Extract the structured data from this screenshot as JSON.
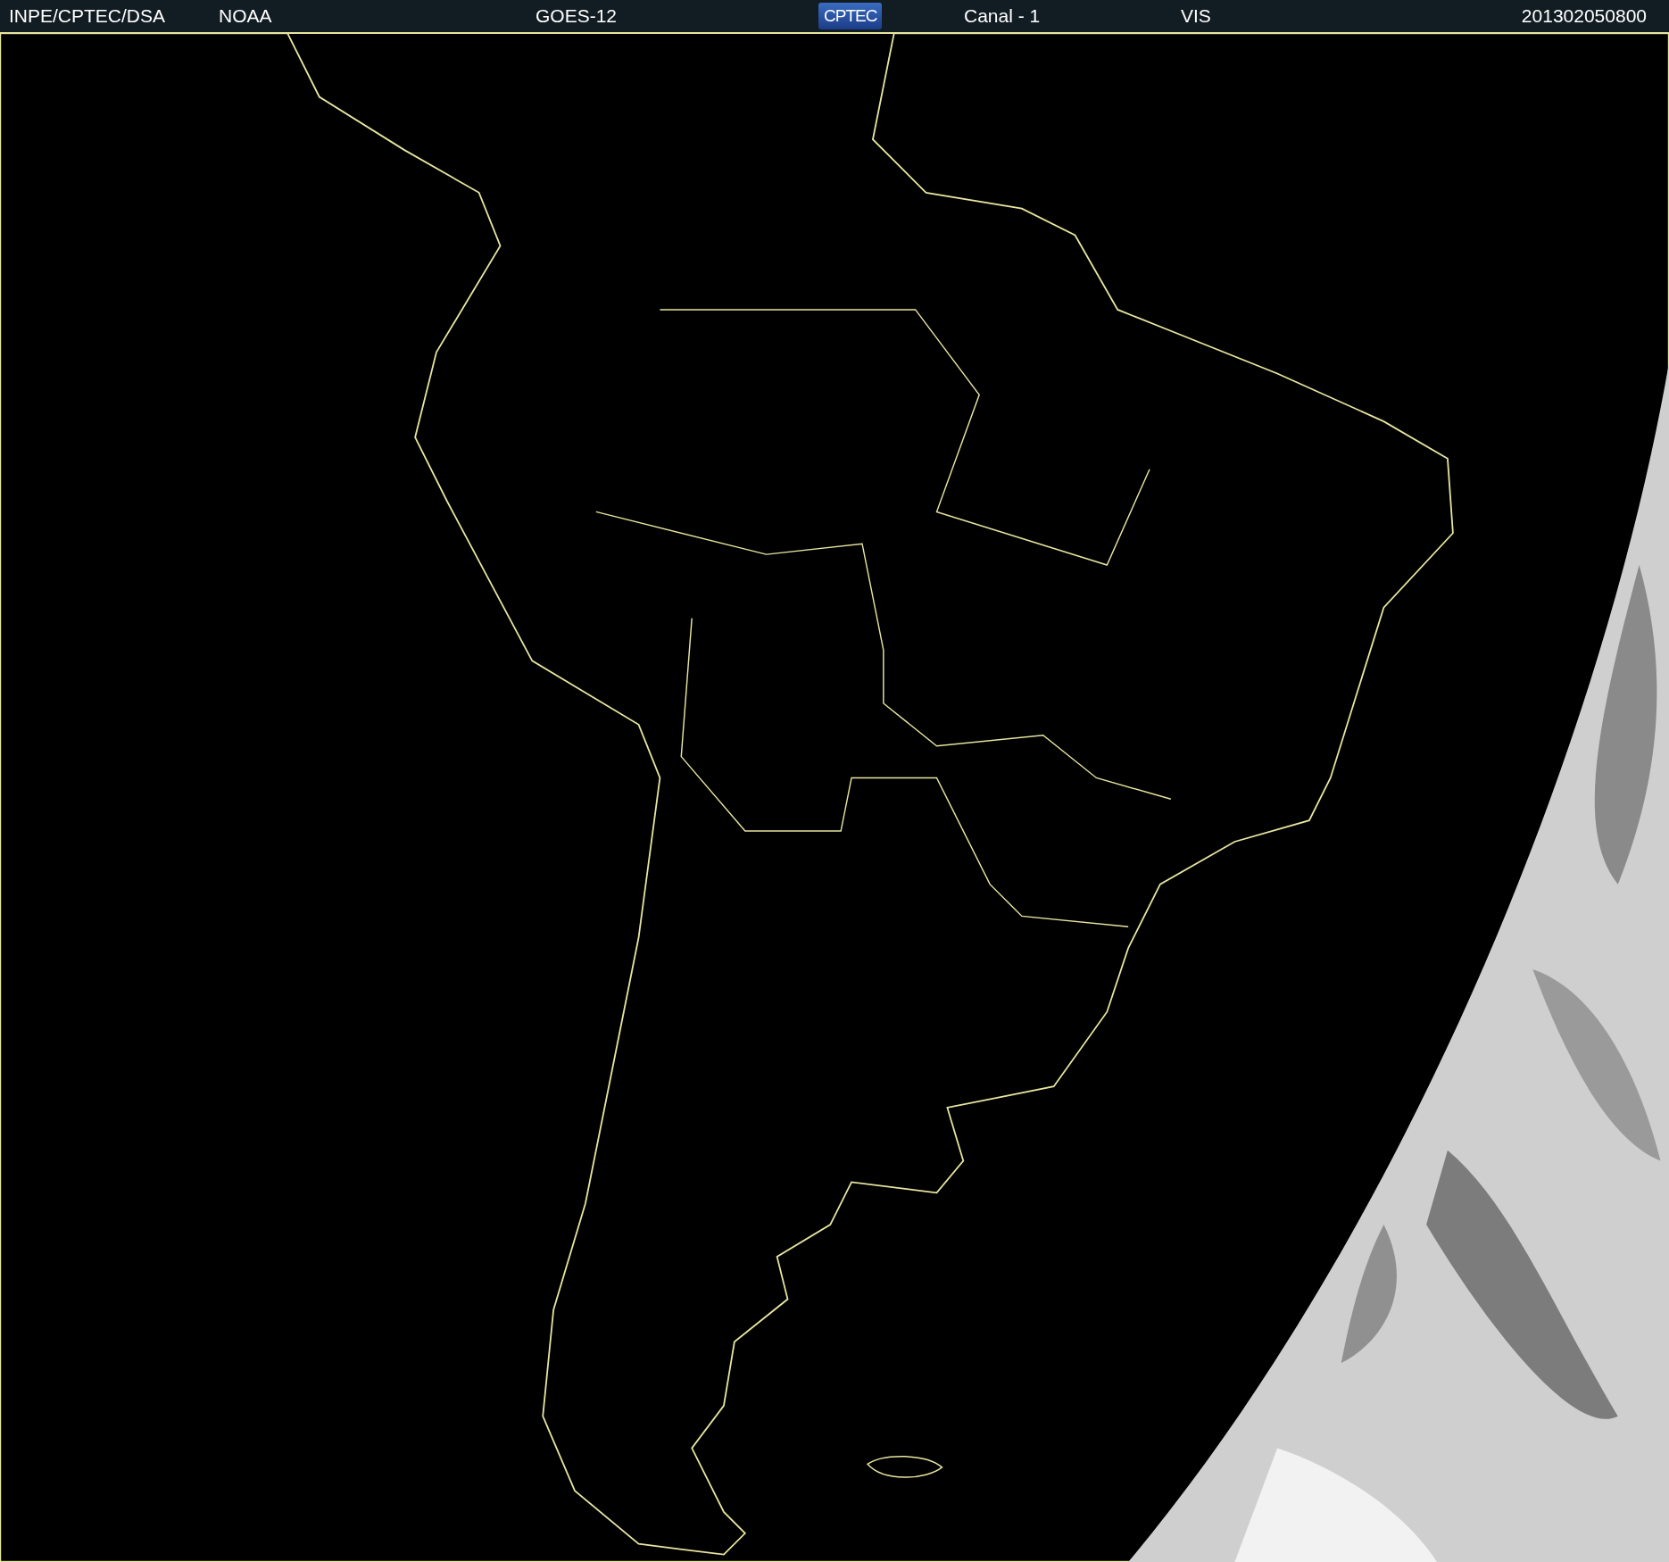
{
  "header": {
    "source": "INPE/CPTEC/DSA",
    "agency": "NOAA",
    "satellite": "GOES-12",
    "logo_text": "CPTEC",
    "channel": "Canal - 1",
    "band": "VIS",
    "timestamp": "201302050800"
  }
}
